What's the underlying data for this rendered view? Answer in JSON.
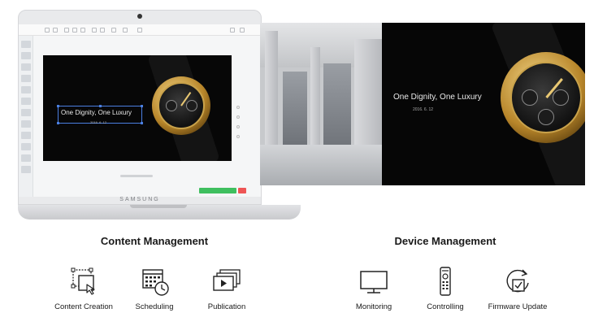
{
  "laptop": {
    "brand": "SAMSUNG",
    "editor": {
      "headline": "One Dignity, One Luxury",
      "date": "2016. 6. 12"
    }
  },
  "signage": {
    "headline": "One Dignity, One Luxury",
    "date": "2016. 6. 12"
  },
  "content_management": {
    "title": "Content Management",
    "features": [
      {
        "label": "Content Creation",
        "icon": "content-creation-icon"
      },
      {
        "label": "Scheduling",
        "icon": "calendar-clock-icon"
      },
      {
        "label": "Publication",
        "icon": "play-stack-icon"
      }
    ]
  },
  "device_management": {
    "title": "Device Management",
    "features": [
      {
        "label": "Monitoring",
        "icon": "monitor-icon"
      },
      {
        "label": "Controlling",
        "icon": "remote-control-icon"
      },
      {
        "label": "Firmware Update",
        "icon": "firmware-update-icon"
      }
    ]
  },
  "colors": {
    "apply_button": "#3fbf5f",
    "selection": "#4a7fe0",
    "watch_gold": "#c9a24a"
  }
}
